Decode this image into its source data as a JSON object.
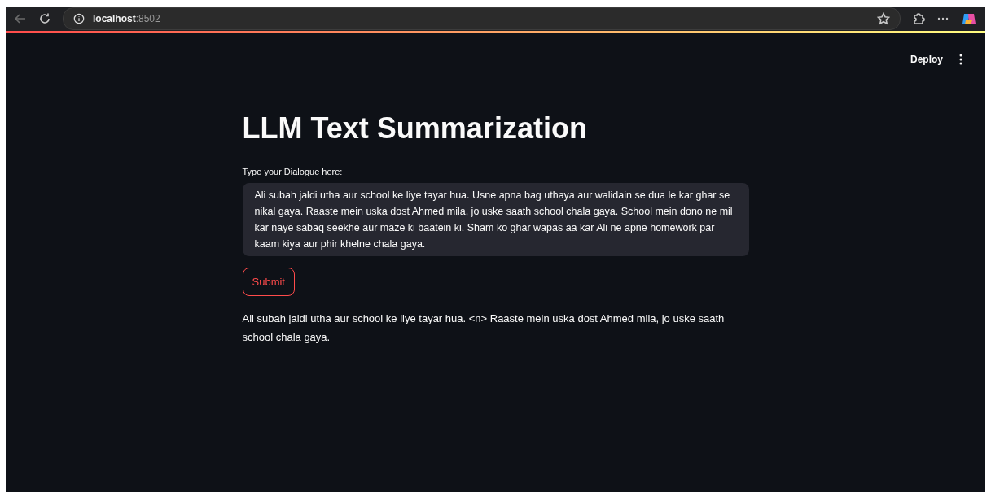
{
  "browser": {
    "host": "localhost",
    "port": ":8502"
  },
  "header": {
    "deploy": "Deploy"
  },
  "main": {
    "title": "LLM Text Summarization",
    "input": {
      "label": "Type your Dialogue here:",
      "value": "Ali subah jaldi utha aur school ke liye tayar hua. Usne apna bag uthaya aur walidain se dua le kar ghar se nikal gaya. Raaste mein uska dost Ahmed mila, jo uske saath school chala gaya. School mein dono ne mil kar naye sabaq seekhe aur maze ki baatein ki. Sham ko ghar wapas aa kar Ali ne apne homework par kaam kiya aur phir khelne chala gaya."
    },
    "submit": "Submit",
    "output": "Ali subah jaldi utha aur school ke liye tayar hua. <n> Raaste mein uska dost Ahmed mila, jo uske saath school chala gaya."
  }
}
